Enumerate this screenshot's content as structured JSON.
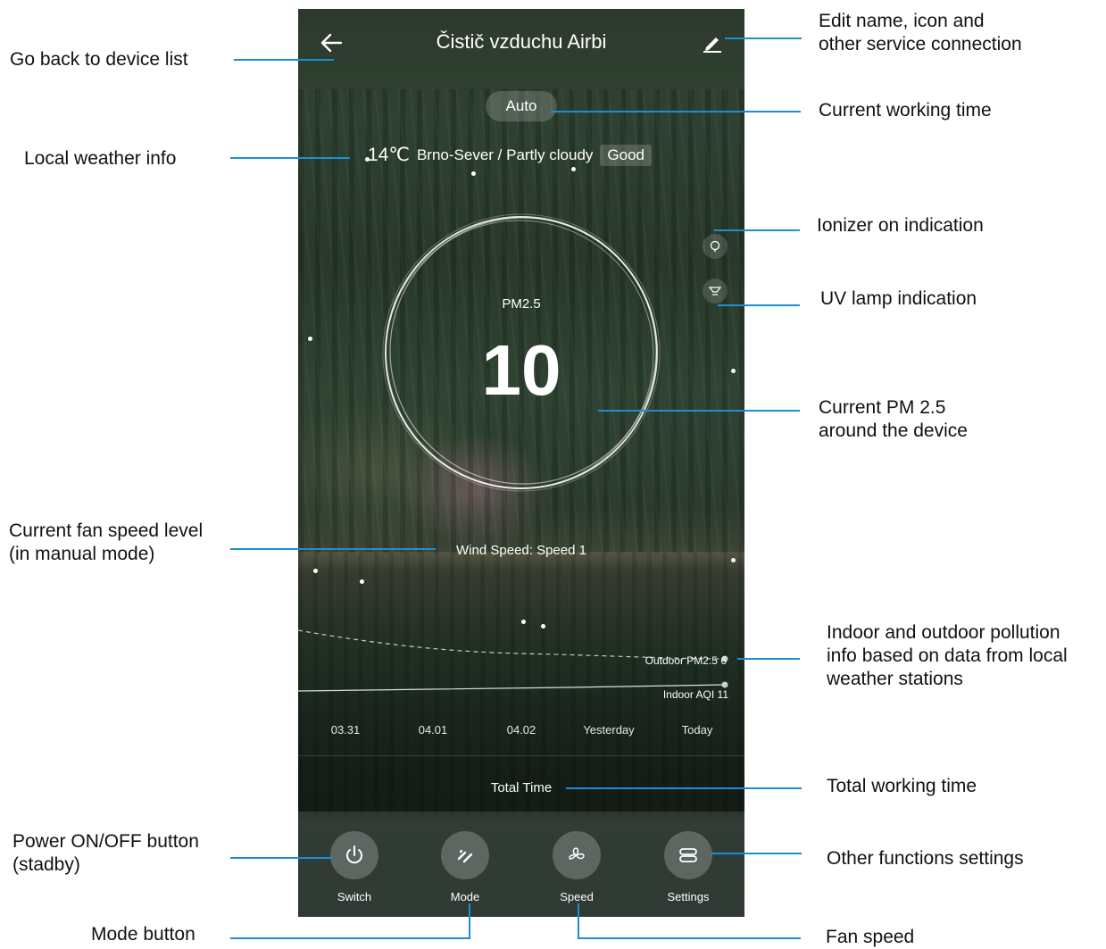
{
  "phone": {
    "title": "Čistič vzduchu Airbi",
    "mode_badge": "Auto",
    "weather": {
      "temperature": "14℃",
      "location_condition": "Brno-Sever / Partly cloudy",
      "quality": "Good"
    },
    "pm": {
      "label": "PM2.5",
      "value": "10"
    },
    "wind_speed": "Wind Speed: Speed 1",
    "chart": {
      "outdoor_label": "Outdoor PM2.5 6",
      "indoor_label": "Indoor AQI 11",
      "dates": [
        "03.31",
        "04.01",
        "04.02",
        "Yesterday",
        "Today"
      ]
    },
    "total_time": "Total Time",
    "buttons": {
      "switch": "Switch",
      "mode": "Mode",
      "speed": "Speed",
      "settings": "Settings"
    },
    "icons": [
      "back-arrow-icon",
      "edit-pencil-icon",
      "ionizer-icon",
      "uv-lamp-icon",
      "power-icon",
      "mode-icon",
      "fan-icon",
      "settings-icon"
    ]
  },
  "annotations": {
    "back": "Go back to device list",
    "edit": "Edit name, icon and\nother service connection",
    "working_time": "Current working time",
    "weather": "Local weather info",
    "ionizer": "Ionizer on indication",
    "uv": "UV lamp indication",
    "pm": "Current PM 2.5\naround the device",
    "fan_level": "Current fan speed level\n(in manual mode)",
    "pollution": "Indoor and outdoor pollution\ninfo based on data from local\nweather stations",
    "total": "Total working time",
    "power": "Power ON/OFF button\n(stadby)",
    "other": "Other functions settings",
    "mode": "Mode button",
    "fan_speed": "Fan speed"
  },
  "colors": {
    "annotation_line": "#1a8fd8"
  }
}
